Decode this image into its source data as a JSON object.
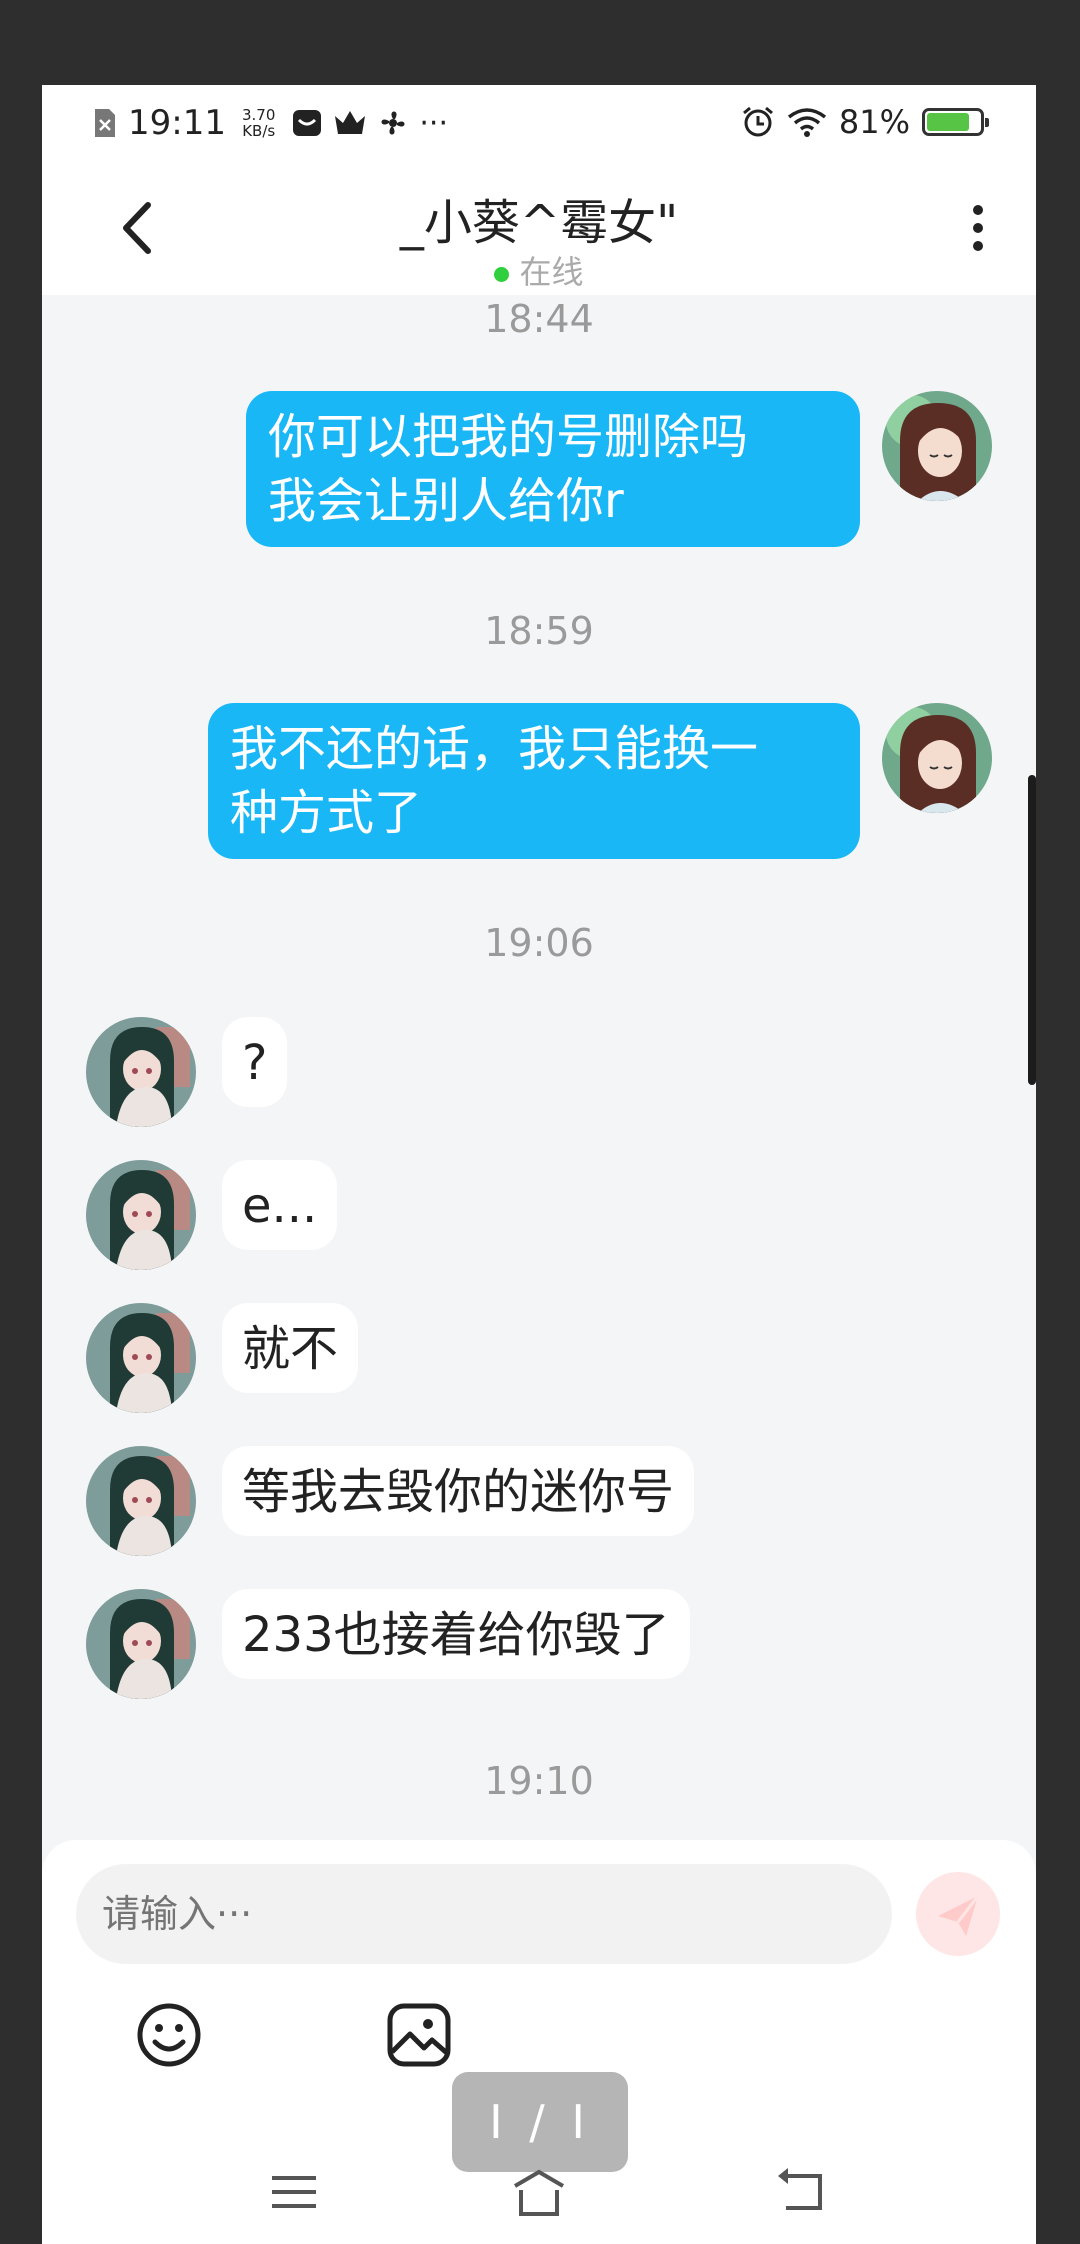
{
  "status_bar": {
    "time": "19:11",
    "speed_value": "3.70",
    "speed_unit": "KB/s",
    "more": "···",
    "battery_percent": "81%",
    "battery_level": 0.81
  },
  "header": {
    "title": "_小葵^霉女\"",
    "presence": "在线",
    "presence_color": "#2fcf3d"
  },
  "messages": [
    {
      "timestamp": "18:44"
    },
    {
      "from": "me",
      "text_lines": [
        "你可以把我的号删除吗",
        "我会让别人给你r"
      ]
    },
    {
      "timestamp": "18:59"
    },
    {
      "from": "me",
      "text_lines": [
        "我不还的话，我只能换一",
        "种方式了"
      ]
    },
    {
      "timestamp": "19:06"
    },
    {
      "from": "them",
      "text": "?"
    },
    {
      "from": "them",
      "text": "e..."
    },
    {
      "from": "them",
      "text": "就不"
    },
    {
      "from": "them",
      "text": "等我去毁你的迷你号"
    },
    {
      "from": "them",
      "text": "233也接着给你毁了"
    },
    {
      "timestamp": "19:10"
    }
  ],
  "composer": {
    "placeholder": "请输入···",
    "icons": [
      "emoji-icon",
      "image-icon",
      "send-icon"
    ]
  },
  "page_indicator": "I / I",
  "nav_icons": [
    "menu-icon",
    "home-icon",
    "back-icon"
  ],
  "colors": {
    "my_bubble": "#1ab7f7",
    "their_bubble": "#ffffff",
    "background": "#f4f5f7"
  }
}
